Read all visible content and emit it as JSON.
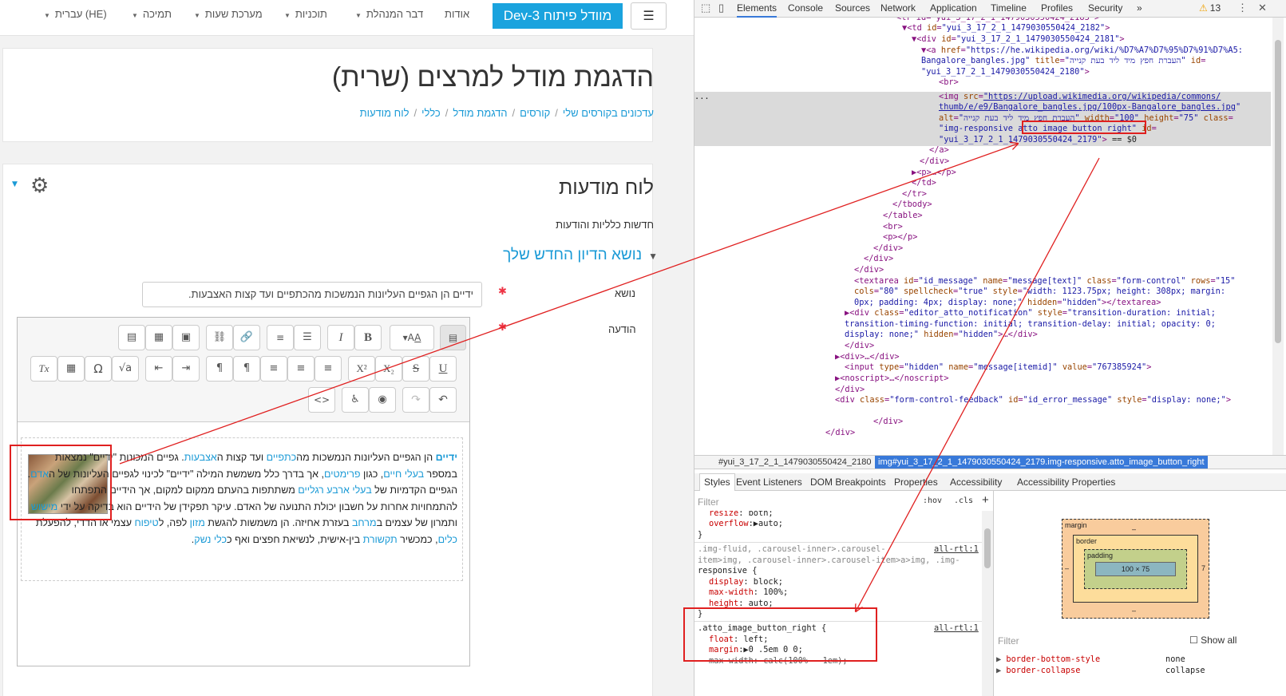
{
  "nav": {
    "brand": "מוודל פיתוח Dev-3",
    "items": [
      "אודות",
      "דבר המנהלת",
      "תוכניות",
      "מערכת שעות",
      "תמיכה",
      "עברית (HE)"
    ]
  },
  "page": {
    "title": "הדגמת מודל למרצים (שרית)",
    "breadcrumb": [
      "עדכונים בקורסים שלי",
      "קורסים",
      "הדגמת מודל",
      "כללי",
      "לוח מודעות"
    ]
  },
  "forum": {
    "title": "לוח מודעות",
    "subtitle": "חדשות כלליות והודעות",
    "new_topic": "נושא הדיון החדש שלך",
    "subject_label": "נושא",
    "subject_value": "ידיים הן הגפיים העליונות הנמשכות מהכתפיים ועד קצות האצבעות.",
    "message_label": "הודעה",
    "required_mark": "✱"
  },
  "editor": {
    "paragraph": [
      {
        "t": "ידיים",
        "l": true,
        "b": true
      },
      {
        "t": " הן הגפיים העליונות הנמשכות מה"
      },
      {
        "t": "כתפיים",
        "l": true
      },
      {
        "t": " ועד קצות ה"
      },
      {
        "t": "אצבעות",
        "l": true
      },
      {
        "t": ". גפיים המכונות \"ידיים\" נמצאות במספר "
      },
      {
        "t": "בעלי חיים",
        "l": true
      },
      {
        "t": ", כגון "
      },
      {
        "t": "פרימטים",
        "l": true
      },
      {
        "t": ", אך בדרך כלל משמשת המילה \"ידיים\" לכינוי לגפיים העליונות של ה"
      },
      {
        "t": "אדם",
        "l": true
      },
      {
        "t": ". הגפיים הקדמיות של "
      },
      {
        "t": "בעלי ארבע רגליים",
        "l": true
      },
      {
        "t": " משתתפות בהעתם ממקום למקום, אך הידיים התפתחו להתמחויות אחרות על חשבון יכולת התנועה של האדם. עיקר תפקידן של הידיים הוא בדיקה על ידי "
      },
      {
        "t": "מישוש",
        "l": true
      },
      {
        "t": " ותמרון של עצמים ב"
      },
      {
        "t": "מרחב",
        "l": true
      },
      {
        "t": " בעזרת אחיזה. הן משמשות להגשת "
      },
      {
        "t": "מזון",
        "l": true
      },
      {
        "t": " לפה, ל"
      },
      {
        "t": "טיפוח",
        "l": true
      },
      {
        "t": " עצמי או הדדי, להפעלת "
      },
      {
        "t": "כלים",
        "l": true
      },
      {
        "t": ", כמכשיר "
      },
      {
        "t": "תקשורת",
        "l": true
      },
      {
        "t": " בין-אישית, לנשיאת חפצים ואף כ"
      },
      {
        "t": "כלי נשק",
        "l": true
      },
      {
        "t": "."
      }
    ]
  },
  "devtools": {
    "tabs": [
      "Elements",
      "Console",
      "Sources",
      "Network",
      "Application",
      "Timeline",
      "Profiles",
      "Security",
      "»"
    ],
    "warnings": "13",
    "breadcrumb": [
      "#yui_3_17_2_1_1479030550424_2180",
      "img#yui_3_17_2_1_1479030550424_2179.img-responsive.atto_image_button_right"
    ],
    "subtabs": [
      "Styles",
      "Event Listeners",
      "DOM Breakpoints",
      "Properties",
      "Accessibility",
      "Accessibility Properties"
    ],
    "filter_placeholder": "Filter",
    "hov": ":hov",
    "cls": ".cls",
    "plus": "+",
    "show_all": "Show all",
    "box": {
      "margin": "margin",
      "border": "border",
      "padding": "padding",
      "content": "100 × 75",
      "dash": "–",
      "left_val": "–",
      "right_val": "7"
    },
    "computed": [
      {
        "prop": "border-bottom-style",
        "val": "none"
      },
      {
        "prop": "border-collapse",
        "val": "collapse"
      }
    ]
  }
}
